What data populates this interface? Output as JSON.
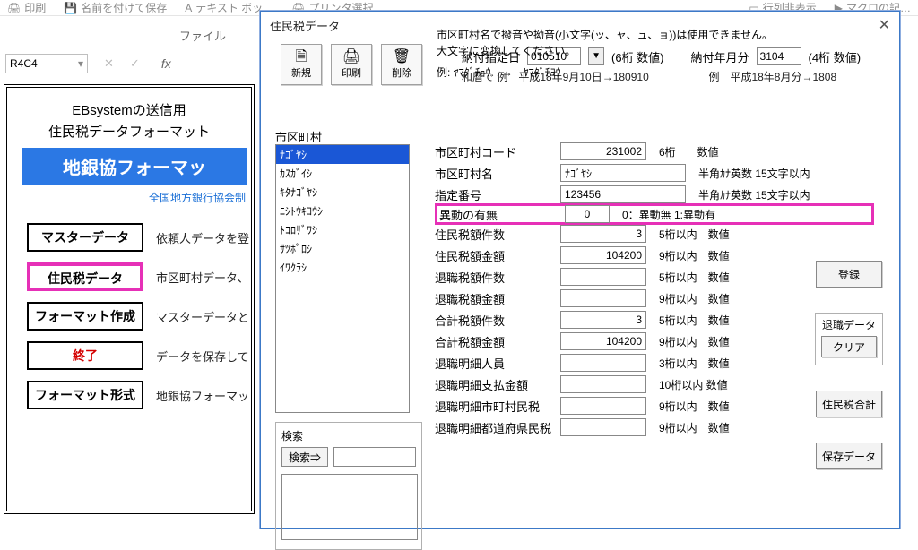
{
  "ribbon": {
    "print": "印刷",
    "saveas": "名前を付けて保存",
    "textbox": "テキスト ボッ…",
    "printer": "プリンタ選択",
    "rowcol": "行列非表示",
    "macro": "マクロの記…"
  },
  "file_label": "ファイル",
  "namebox": "R4C4",
  "fx": "fx",
  "sheet": {
    "title1": "EBsystemの送信用",
    "title2": "住民税データフォーマット",
    "banner": "地銀協フォーマッ",
    "assoc": "全国地方銀行協会制",
    "buttons": {
      "master": "マスターデータ",
      "resident": "住民税データ",
      "formatmake": "フォーマット作成",
      "exit": "終了",
      "formatstyle": "フォーマット形式"
    },
    "desc": {
      "master": "依頼人データを登",
      "resident": "市区町村データ、",
      "formatmake": "マスターデータと",
      "exit": "データを保存して",
      "formatstyle": "地銀協フォーマッ"
    }
  },
  "dlg": {
    "title": "住民税データ",
    "toolbar": {
      "new": "新規",
      "print": "印刷",
      "delete": "削除"
    },
    "hdr": {
      "paydate_lbl": "納付指定日",
      "paydate": "010510",
      "paydate_note": "(6桁  数値)",
      "paydate_ex": "和暦で 例　平成18年9月10日→180910",
      "paymonth_lbl": "納付年月分",
      "paymonth": "3104",
      "paymonth_note": "(4桁  数値)",
      "paymonth_ex": "例　平成18年8月分→1808"
    },
    "muni_label": "市区町村",
    "muni_items": [
      "ﾅｺﾞﾔｼ",
      "ｶｽｶﾞｲｼ",
      "ｷﾀﾅｺﾞﾔｼ",
      "ﾆｼﾄｳｷﾖｳｼ",
      "ﾄｺﾛｻﾞﾜｼ",
      "ｻﾂﾎﾟﾛｼ",
      "ｲﾜｸﾗｼ"
    ],
    "search": {
      "label": "検索",
      "button": "検索⇒"
    },
    "fields": {
      "code_lbl": "市区町村コード",
      "code": "231002",
      "code_note": "6桁　　数値",
      "name_lbl": "市区町村名",
      "name": "ﾅｺﾞﾔｼ",
      "name_note": "半角ｶﾅ英数  15文字以内",
      "num_lbl": "指定番号",
      "num": "123456",
      "num_note": "半角ｶﾅ英数  15文字以内",
      "hasmove_lbl": "異動の有無",
      "hasmove": "0",
      "hasmove_note": "0：異動無  1:異動有",
      "rescnt_lbl": "住民税額件数",
      "rescnt": "3",
      "rescnt_note": "5桁以内　数値",
      "resamt_lbl": "住民税額金額",
      "resamt": "104200",
      "resamt_note": "9桁以内　数値",
      "retcnt_lbl": "退職税額件数",
      "retcnt": "",
      "retcnt_note": "5桁以内　数値",
      "retamt_lbl": "退職税額金額",
      "retamt": "",
      "retamt_note": "9桁以内　数値",
      "totcnt_lbl": "合計税額件数",
      "totcnt": "3",
      "totcnt_note": "5桁以内　数値",
      "totamt_lbl": "合計税額金額",
      "totamt": "104200",
      "totamt_note": "9桁以内　数値",
      "retppl_lbl": "退職明細人員",
      "retppl": "",
      "retppl_note": "3桁以内　数値",
      "retpay_lbl": "退職明細支払金額",
      "retpay": "",
      "retpay_note": "10桁以内  数値",
      "retmuni_lbl": "退職明細市町村民税",
      "retmuni": "",
      "retmuni_note": "9桁以内　数値",
      "retpref_lbl": "退職明細都道府県民税",
      "retpref": "",
      "retpref_note": "9桁以内　数値"
    },
    "help1": "市区町村名で撥音や拗音(小文字(ッ、ャ、ュ、ョ))は使用できません。大文字に変換してください。",
    "help2": "例: ﾔﾏﾀﾞﾁｮｳ　→　ﾔﾏﾀﾞﾁﾖｳ",
    "rbuttons": {
      "register": "登録",
      "retire_title": "退職データ",
      "clear": "クリア",
      "total": "住民税合計",
      "save": "保存データ"
    }
  }
}
